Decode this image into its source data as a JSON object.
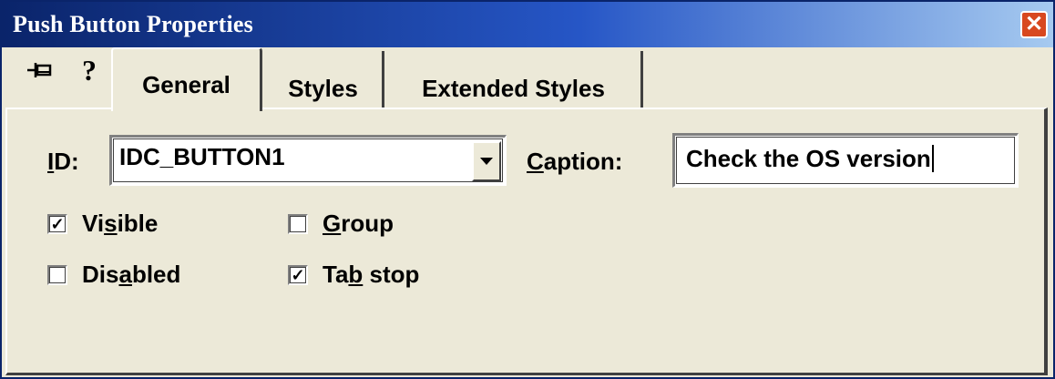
{
  "window": {
    "title": "Push Button Properties",
    "close_glyph": "✕"
  },
  "toolbar": {
    "pin_icon": "pushpin-icon",
    "pin_glyph": "⊣⊏",
    "help_icon": "help-icon",
    "help_glyph": "?"
  },
  "tabs": [
    {
      "label": "General",
      "active": true
    },
    {
      "label": "Styles",
      "active": false
    },
    {
      "label": "Extended Styles",
      "active": false
    }
  ],
  "general": {
    "id_label_accel": "I",
    "id_label_rest": "D:",
    "id_value": "IDC_BUTTON1",
    "caption_label_accel": "C",
    "caption_label_rest": "aption:",
    "caption_value": "Check the OS version",
    "checkboxes": {
      "visible": {
        "pre": "Vi",
        "accel": "s",
        "post": "ible",
        "checked": true
      },
      "group": {
        "pre": "",
        "accel": "G",
        "post": "roup",
        "checked": false
      },
      "disabled": {
        "pre": "Dis",
        "accel": "a",
        "post": "bled",
        "checked": false
      },
      "tabstop": {
        "pre": "Ta",
        "accel": "b",
        "post": " stop",
        "checked": true
      }
    },
    "check_glyph": "✓"
  },
  "colors": {
    "titlebar_start": "#0a246a",
    "titlebar_end": "#a6caf0",
    "face": "#ece9d8",
    "close": "#d8481f"
  }
}
